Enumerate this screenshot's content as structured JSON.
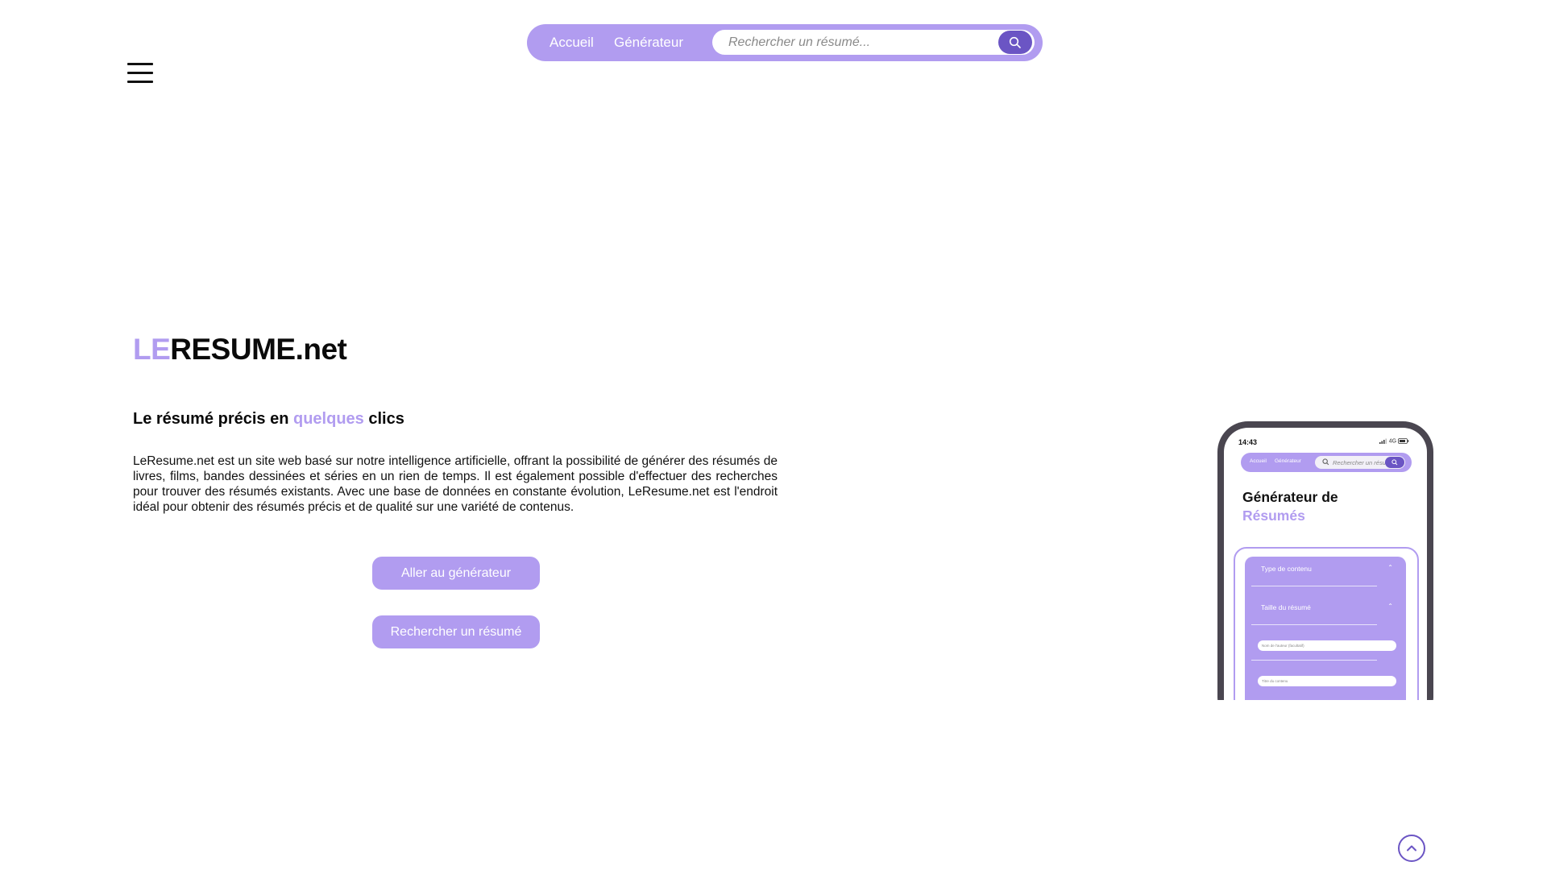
{
  "nav": {
    "home_label": "Accueil",
    "generator_label": "Générateur",
    "search_placeholder": "Rechercher un résumé..."
  },
  "hero": {
    "brand_prefix": "LE",
    "brand_rest": "RESUME.net",
    "tagline_start": "Le résumé précis en",
    "tagline_highlight": "quelques",
    "tagline_end": "clics",
    "description": "LeResume.net est un site web basé sur notre intelligence artificielle, offrant la possibilité de générer des résumés de livres, films, bandes dessinées et séries en un rien de temps. Il est également possible d'effectuer des recherches pour trouver des résumés existants. Avec une base de données en constante évolution, LeResume.net est l'endroit idéal pour obtenir des résumés précis et de qualité sur une variété de contenus.",
    "generator_button": "Aller au générateur",
    "search_button": "Rechercher un résumé"
  },
  "phone": {
    "time": "14:43",
    "status": "4G",
    "nav_home": "Accueil",
    "nav_generator": "Générateur",
    "search_placeholder": "Rechercher un résumé...",
    "title_line1": "Générateur de",
    "title_line2": "Résumés",
    "select_content_type": "Type de contenu",
    "select_summary_size": "Taille du résumé",
    "field_author": "Nom de l'auteur (facultatif)",
    "field_title": "Titre du contenu"
  },
  "colors": {
    "accent": "#b19cf0",
    "accent_dark": "#6b55c4",
    "text": "#0a0a0a"
  },
  "icons": {
    "search": "search-icon",
    "menu": "hamburger-menu-icon",
    "scroll_top": "chevron-up-icon"
  }
}
